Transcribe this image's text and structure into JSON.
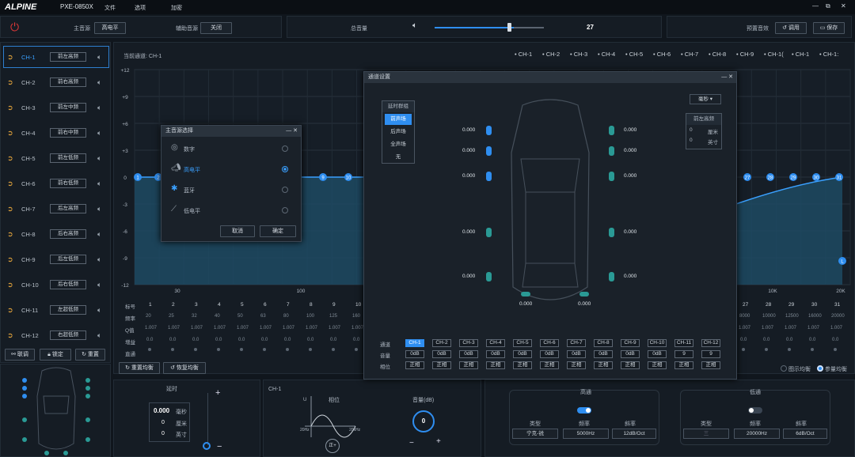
{
  "window": {
    "brand": "ALPINE",
    "model": "PXE-0850X",
    "menu": [
      "文件",
      "选项",
      "加密"
    ],
    "controls": [
      "—",
      "⧉",
      "✕"
    ]
  },
  "topbar": {
    "main_source_label": "主音源",
    "main_source_value": "高电平",
    "aux_source_label": "辅助音源",
    "aux_source_value": "关闭",
    "volume_label": "总音量",
    "volume_value": "27",
    "volume_fraction": 0.4,
    "preset_label": "预置音效",
    "load_btn": "调用",
    "save_btn": "保存"
  },
  "channels": [
    {
      "name": "CH-1",
      "label": "前左高频"
    },
    {
      "name": "CH-2",
      "label": "前右高频"
    },
    {
      "name": "CH-3",
      "label": "前左中频"
    },
    {
      "name": "CH-4",
      "label": "前右中频"
    },
    {
      "name": "CH-5",
      "label": "前左低频"
    },
    {
      "name": "CH-6",
      "label": "前右低频"
    },
    {
      "name": "CH-7",
      "label": "后左高频"
    },
    {
      "name": "CH-8",
      "label": "后右高频"
    },
    {
      "name": "CH-9",
      "label": "后左低频"
    },
    {
      "name": "CH-10",
      "label": "后右低频"
    },
    {
      "name": "CH-11",
      "label": "左超低频"
    },
    {
      "name": "CH-12",
      "label": "右超低频"
    }
  ],
  "left_bottom": {
    "link": "联调",
    "lock": "锁定",
    "reset": "重置"
  },
  "eq": {
    "current_label": "当前通道: CH-1",
    "channel_tabs": [
      "CH-1",
      "CH-2",
      "CH-3",
      "CH-4",
      "CH-5",
      "CH-6",
      "CH-7",
      "CH-8",
      "CH-9",
      "CH-1(",
      "CH-1",
      "CH-1:"
    ],
    "y_ticks": [
      "+12",
      "+9",
      "+6",
      "+3",
      "0",
      "-3",
      "-6",
      "-9",
      "-12"
    ],
    "x_ticks": [
      "30",
      "100",
      "10K",
      "20K"
    ],
    "nodes_left": [
      "1",
      "2"
    ],
    "nodes_mid": [
      "9",
      "10"
    ],
    "nodes_right": [
      "27",
      "28",
      "29",
      "30",
      "31"
    ],
    "L": "L",
    "row_labels": [
      "标号",
      "频率",
      "Q值",
      "增益",
      "直通"
    ],
    "left_idx": [
      "1",
      "2",
      "3",
      "4",
      "5",
      "6",
      "7",
      "8",
      "9",
      "10"
    ],
    "left_freq": [
      "20",
      "25",
      "32",
      "40",
      "50",
      "63",
      "80",
      "100",
      "125",
      "160"
    ],
    "right_idx": [
      "27",
      "28",
      "29",
      "30",
      "31"
    ],
    "right_freq": [
      "8000",
      "10000",
      "12500",
      "16000",
      "20000"
    ],
    "q": "1.007",
    "gain": "0.0",
    "reset_eq": "重置均衡",
    "restore_eq": "恢复均衡",
    "graphic_eq": "图示均衡",
    "param_eq": "参量均衡"
  },
  "source_dialog": {
    "title": "主音源选择",
    "options": [
      "数字",
      "高电平",
      "蓝牙",
      "低电平"
    ],
    "selected": 1,
    "cancel": "取消",
    "ok": "确定"
  },
  "channel_dialog": {
    "title": "通道设置",
    "delay_group": "延时群组",
    "groups": [
      "前声场",
      "后声场",
      "全声场",
      "无"
    ],
    "unit": "毫秒",
    "pos_label": "前左高频",
    "dist_cm": "0",
    "cm": "厘米",
    "dist_in": "0",
    "inch": "英寸",
    "delays": [
      "0.000",
      "0.000",
      "0.000",
      "0.000",
      "0.000",
      "0.000",
      "0.000",
      "0.000",
      "0.000",
      "0.000",
      "0.000",
      "0.000"
    ],
    "row_labels": [
      "通道",
      "音量",
      "相位"
    ],
    "chs": [
      "CH-1",
      "CH-2",
      "CH-3",
      "CH-4",
      "CH-5",
      "CH-6",
      "CH-7",
      "CH-8",
      "CH-9",
      "CH-10",
      "CH-11",
      "CH-12"
    ],
    "vols": [
      "0dB",
      "0dB",
      "0dB",
      "0dB",
      "0dB",
      "0dB",
      "0dB",
      "0dB",
      "0dB",
      "0dB",
      "9",
      "9"
    ],
    "phase": "正相"
  },
  "bottom": {
    "delay_title": "延时",
    "delay_ms": "0.000",
    "ms": "毫秒",
    "delay_cm": "0",
    "cm": "厘米",
    "delay_in": "0",
    "inch": "英寸",
    "plus": "+",
    "minus": "−",
    "ch": "CH-1",
    "phase_title": "相位",
    "u": "U",
    "f20": "20Hz",
    "f20k": "20kHz",
    "phase_btn": "正+",
    "gain_title": "音量(dB)",
    "gain_val": "0",
    "hp": {
      "title": "高通",
      "type_l": "类型",
      "freq_l": "频率",
      "slope_l": "斜率",
      "type": "宁克-锐",
      "freq": "5000Hz",
      "slope": "12dB/Oct",
      "on": true
    },
    "lp": {
      "title": "低通",
      "type_l": "类型",
      "freq_l": "频率",
      "slope_l": "斜率",
      "type": "三",
      "freq": "20000Hz",
      "slope": "6dB/Oct",
      "on": false
    }
  },
  "colors": {
    "accent": "#2f8ef0",
    "active": "#3aa0ff",
    "fill": "#1d4a63"
  }
}
